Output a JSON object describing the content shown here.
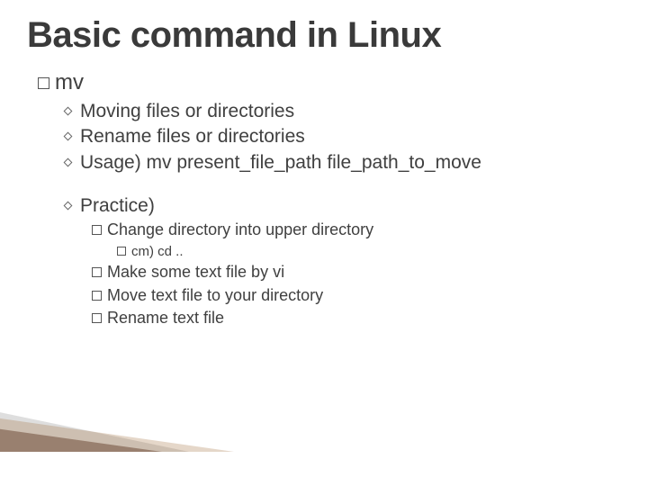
{
  "title": "Basic command in Linux",
  "command": "mv",
  "bullets": {
    "b1": "Moving files or directories",
    "b2": "Rename files or directories",
    "b3": "Usage) mv present_file_path file_path_to_move",
    "practice_label": "Practice)",
    "p1": "Change directory into upper directory",
    "p1a": "cm) cd ..",
    "p2": "Make some text file by vi",
    "p3": "Move text file to your directory",
    "p4": "Rename text file"
  }
}
